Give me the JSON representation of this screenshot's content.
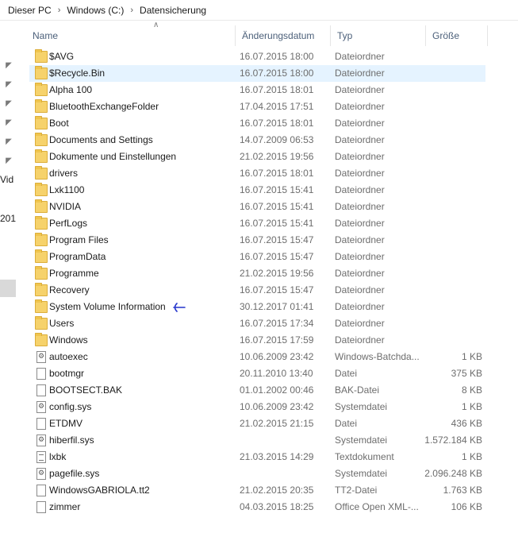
{
  "breadcrumb": [
    "Dieser PC",
    "Windows (C:)",
    "Datensicherung"
  ],
  "left_pane": {
    "text1": "Vid",
    "text2": "201"
  },
  "header": {
    "name": "Name",
    "date": "Änderungsdatum",
    "type": "Typ",
    "size": "Größe"
  },
  "rows": [
    {
      "name": "$AVG",
      "date": "16.07.2015 18:00",
      "type": "Dateiordner",
      "size": "",
      "icon": "folder-icon"
    },
    {
      "name": "$Recycle.Bin",
      "date": "16.07.2015 18:00",
      "type": "Dateiordner",
      "size": "",
      "icon": "folder-icon"
    },
    {
      "name": "Alpha 100",
      "date": "16.07.2015 18:01",
      "type": "Dateiordner",
      "size": "",
      "icon": "folder-icon"
    },
    {
      "name": "BluetoothExchangeFolder",
      "date": "17.04.2015 17:51",
      "type": "Dateiordner",
      "size": "",
      "icon": "folder-icon"
    },
    {
      "name": "Boot",
      "date": "16.07.2015 18:01",
      "type": "Dateiordner",
      "size": "",
      "icon": "folder-icon"
    },
    {
      "name": "Documents and Settings",
      "date": "14.07.2009 06:53",
      "type": "Dateiordner",
      "size": "",
      "icon": "folder-icon"
    },
    {
      "name": "Dokumente und Einstellungen",
      "date": "21.02.2015 19:56",
      "type": "Dateiordner",
      "size": "",
      "icon": "folder-icon"
    },
    {
      "name": "drivers",
      "date": "16.07.2015 18:01",
      "type": "Dateiordner",
      "size": "",
      "icon": "folder-icon"
    },
    {
      "name": "Lxk1100",
      "date": "16.07.2015 15:41",
      "type": "Dateiordner",
      "size": "",
      "icon": "folder-icon"
    },
    {
      "name": "NVIDIA",
      "date": "16.07.2015 15:41",
      "type": "Dateiordner",
      "size": "",
      "icon": "folder-icon"
    },
    {
      "name": "PerfLogs",
      "date": "16.07.2015 15:41",
      "type": "Dateiordner",
      "size": "",
      "icon": "folder-icon"
    },
    {
      "name": "Program Files",
      "date": "16.07.2015 15:47",
      "type": "Dateiordner",
      "size": "",
      "icon": "folder-icon"
    },
    {
      "name": "ProgramData",
      "date": "16.07.2015 15:47",
      "type": "Dateiordner",
      "size": "",
      "icon": "folder-icon"
    },
    {
      "name": "Programme",
      "date": "21.02.2015 19:56",
      "type": "Dateiordner",
      "size": "",
      "icon": "folder-icon"
    },
    {
      "name": "Recovery",
      "date": "16.07.2015 15:47",
      "type": "Dateiordner",
      "size": "",
      "icon": "folder-icon"
    },
    {
      "name": "System Volume Information",
      "date": "30.12.2017 01:41",
      "type": "Dateiordner",
      "size": "",
      "icon": "folder-icon"
    },
    {
      "name": "Users",
      "date": "16.07.2015 17:34",
      "type": "Dateiordner",
      "size": "",
      "icon": "folder-icon"
    },
    {
      "name": "Windows",
      "date": "16.07.2015 17:59",
      "type": "Dateiordner",
      "size": "",
      "icon": "folder-icon"
    },
    {
      "name": "autoexec",
      "date": "10.06.2009 23:42",
      "type": "Windows-Batchda...",
      "size": "1 KB",
      "icon": "batch-file-icon"
    },
    {
      "name": "bootmgr",
      "date": "20.11.2010 13:40",
      "type": "Datei",
      "size": "375 KB",
      "icon": "file-icon"
    },
    {
      "name": "BOOTSECT.BAK",
      "date": "01.01.2002 00:46",
      "type": "BAK-Datei",
      "size": "8 KB",
      "icon": "file-icon"
    },
    {
      "name": "config.sys",
      "date": "10.06.2009 23:42",
      "type": "Systemdatei",
      "size": "1 KB",
      "icon": "system-file-icon"
    },
    {
      "name": "ETDMV",
      "date": "21.02.2015 21:15",
      "type": "Datei",
      "size": "436 KB",
      "icon": "file-icon"
    },
    {
      "name": "hiberfil.sys",
      "date": "",
      "type": "Systemdatei",
      "size": "1.572.184 KB",
      "icon": "system-file-icon"
    },
    {
      "name": "lxbk",
      "date": "21.03.2015 14:29",
      "type": "Textdokument",
      "size": "1 KB",
      "icon": "text-file-icon"
    },
    {
      "name": "pagefile.sys",
      "date": "",
      "type": "Systemdatei",
      "size": "2.096.248 KB",
      "icon": "system-file-icon"
    },
    {
      "name": "WindowsGABRIOLA.tt2",
      "date": "21.02.2015 20:35",
      "type": "TT2-Datei",
      "size": "1.763 KB",
      "icon": "file-icon"
    },
    {
      "name": "zimmer",
      "date": "04.03.2015 18:25",
      "type": "Office Open XML-...",
      "size": "106 KB",
      "icon": "file-icon"
    }
  ],
  "selected_index": 1,
  "annotated_index": 15,
  "colors": {
    "selection": "#e5f3ff",
    "folder": "#f6d26b",
    "annotation": "#2233cc"
  }
}
